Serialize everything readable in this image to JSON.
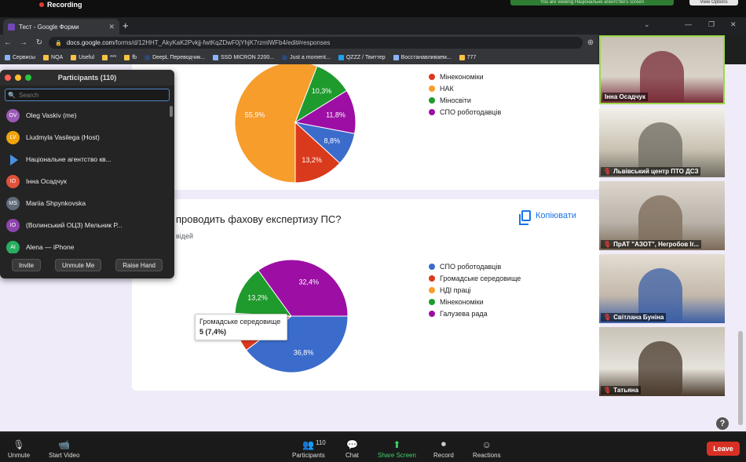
{
  "recording": {
    "label": "Recording",
    "viewing_text": "You are viewing Національне агентство's screen",
    "view_options": "View Options"
  },
  "browser": {
    "tab_title": "Тест - Google Форми",
    "url_host": "docs.google.com",
    "url_path": "/forms/d/12HHT_AkyKaK2Pvkjj-fwtKqZDwF0jYhjK7rzmlWFb4/edit#responses",
    "bookmarks": [
      "Сервисы",
      "NQA",
      "Useful",
      "***",
      "fb",
      "DeepL Переводчик...",
      "SSD MICRON 2200...",
      "Just a moment...",
      "QZZZ / Твиттер",
      "Восстанавливаем...",
      "777"
    ]
  },
  "form": {
    "question2_title": "проводить фахову експертизу ПС?",
    "question2_sub": "відей",
    "copy_label": "Копіювати",
    "tooltip_title": "Громадське середовище",
    "tooltip_value": "5 (7,4%)"
  },
  "chart_data": [
    {
      "type": "pie",
      "legend": [
        "Мінекономіки",
        "НАК",
        "Міносвіти",
        "СПО роботодавців"
      ],
      "slices": [
        {
          "label": "НАК",
          "value": 55.9,
          "color": "#f79d2b"
        },
        {
          "label": "Міносвіти",
          "value": 10.3,
          "color": "#1e9b2c"
        },
        {
          "label": "СПО роботодавців",
          "value": 11.8,
          "color": "#9c0ea4"
        },
        {
          "label": "",
          "value": 8.8,
          "color": "#3b6ccb"
        },
        {
          "label": "",
          "value": 13.2,
          "color": "#da3a1c"
        }
      ],
      "value_labels": [
        "55,9%",
        "10,3%",
        "11,8%",
        "8,8%",
        "13,2%"
      ],
      "legend_colors": [
        "#da3a1c",
        "#f79d2b",
        "#1e9b2c",
        "#9c0ea4"
      ]
    },
    {
      "type": "pie",
      "legend": [
        "СПО роботодавців",
        "Громадське середовище",
        "НДІ праці",
        "Мінекономіки",
        "Галузева рада"
      ],
      "slices": [
        {
          "label": "СПО роботодавців",
          "value": 36.8,
          "color": "#3b6ccb"
        },
        {
          "label": "Громадське середовище",
          "value": 7.4,
          "color": "#da3a1c"
        },
        {
          "label": "НДІ праці",
          "value": 2.9,
          "color": "#f79d2b"
        },
        {
          "label": "Мінекономіки",
          "value": 13.2,
          "color": "#1e9b2c"
        },
        {
          "label": "Галузева рада",
          "value": 32.4,
          "color": "#9c0ea4"
        }
      ],
      "value_labels": [
        "36,8%",
        "",
        "",
        "13,2%",
        "32,4%"
      ],
      "legend_colors": [
        "#3b6ccb",
        "#da3a1c",
        "#f79d2b",
        "#1e9b2c",
        "#9c0ea4"
      ]
    }
  ],
  "participants": {
    "title": "Participants (110)",
    "search_placeholder": "Search",
    "list": [
      {
        "initials": "OV",
        "name": "Oleg Vaskiv (me)",
        "color": "#9b59b6"
      },
      {
        "initials": "LV",
        "name": "Liudmyla Vasilega (Host)",
        "color": "#f0a30a"
      },
      {
        "initials": "",
        "name": "Національне агентство кв...",
        "color": ""
      },
      {
        "initials": "IO",
        "name": "Інна Осадчук",
        "color": "#e0523a"
      },
      {
        "initials": "MS",
        "name": "Mariia Shpynkovska",
        "color": "#5f6b7a"
      },
      {
        "initials": "IO",
        "name": "(Волинський ОЦЗ) Мельник Р...",
        "color": "#8e44ad"
      },
      {
        "initials": "AI",
        "name": "Alena — iPhone",
        "color": "#27ae60"
      }
    ],
    "invite": "Invite",
    "unmute": "Unmute Me",
    "raise": "Raise Hand"
  },
  "videos": [
    {
      "name": "Інна Осадчук",
      "muted": false
    },
    {
      "name": "Львівський центр ПТО ДСЗ",
      "muted": true
    },
    {
      "name": "ПрАТ \"АЗОТ\", Негробов Іг...",
      "muted": true
    },
    {
      "name": "Світлана Буніна",
      "muted": true
    },
    {
      "name": "Татьяна",
      "muted": true
    }
  ],
  "toolbar": {
    "unmute": "Unmute",
    "start_video": "Start Video",
    "participants_count": "110",
    "participants": "Participants",
    "chat": "Chat",
    "share": "Share Screen",
    "record": "Record",
    "reactions": "Reactions",
    "leave": "Leave"
  }
}
